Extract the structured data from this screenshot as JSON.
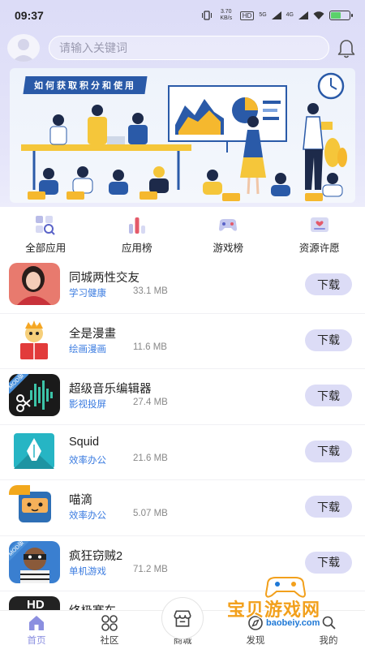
{
  "status": {
    "time": "09:37",
    "net_speed": "3.70 KB/s",
    "hd": "HD",
    "sig1": "5G",
    "sig2": "4G"
  },
  "search": {
    "placeholder": "请输入关键词"
  },
  "banner": {
    "title": "如何获取积分和使用"
  },
  "categories": [
    {
      "label": "全部应用",
      "icon": "grid-search-icon"
    },
    {
      "label": "应用榜",
      "icon": "bar-chart-icon"
    },
    {
      "label": "游戏榜",
      "icon": "gamepad-icon"
    },
    {
      "label": "资源许愿",
      "icon": "wish-card-icon"
    }
  ],
  "apps": [
    {
      "name": "同城两性交友",
      "category": "学习健康",
      "size": "33.1 MB",
      "button": "下载"
    },
    {
      "name": "全是漫畫",
      "category": "绘画漫画",
      "size": "11.6 MB",
      "button": "下载"
    },
    {
      "name": "超级音乐编辑器",
      "category": "影视投屏",
      "size": "27.4 MB",
      "button": "下载"
    },
    {
      "name": "Squid",
      "category": "效率办公",
      "size": "21.6 MB",
      "button": "下载"
    },
    {
      "name": "喵滴",
      "category": "效率办公",
      "size": "5.07 MB",
      "button": "下载"
    },
    {
      "name": "疯狂窃贼2",
      "category": "单机游戏",
      "size": "71.2 MB",
      "button": "下载"
    },
    {
      "name": "终极赛车",
      "category": "",
      "size": "",
      "button": ""
    }
  ],
  "icon_badges": {
    "mod": "MOD版",
    "hd": "HD"
  },
  "nav": [
    {
      "label": "首页",
      "icon": "home-icon",
      "active": true
    },
    {
      "label": "社区",
      "icon": "community-icon",
      "active": false
    },
    {
      "label": "商城",
      "icon": "shop-icon",
      "active": false
    },
    {
      "label": "发现",
      "icon": "discover-icon",
      "active": false
    },
    {
      "label": "我的",
      "icon": "profile-icon",
      "active": false
    }
  ],
  "watermark": {
    "text": "宝贝游戏网",
    "url": "baobeiy.com"
  },
  "colors": {
    "accent": "#8b8fe0",
    "button_bg": "#dcdcf6",
    "category_text": "#3a7be0",
    "header_bg": "#dcdcf7"
  }
}
